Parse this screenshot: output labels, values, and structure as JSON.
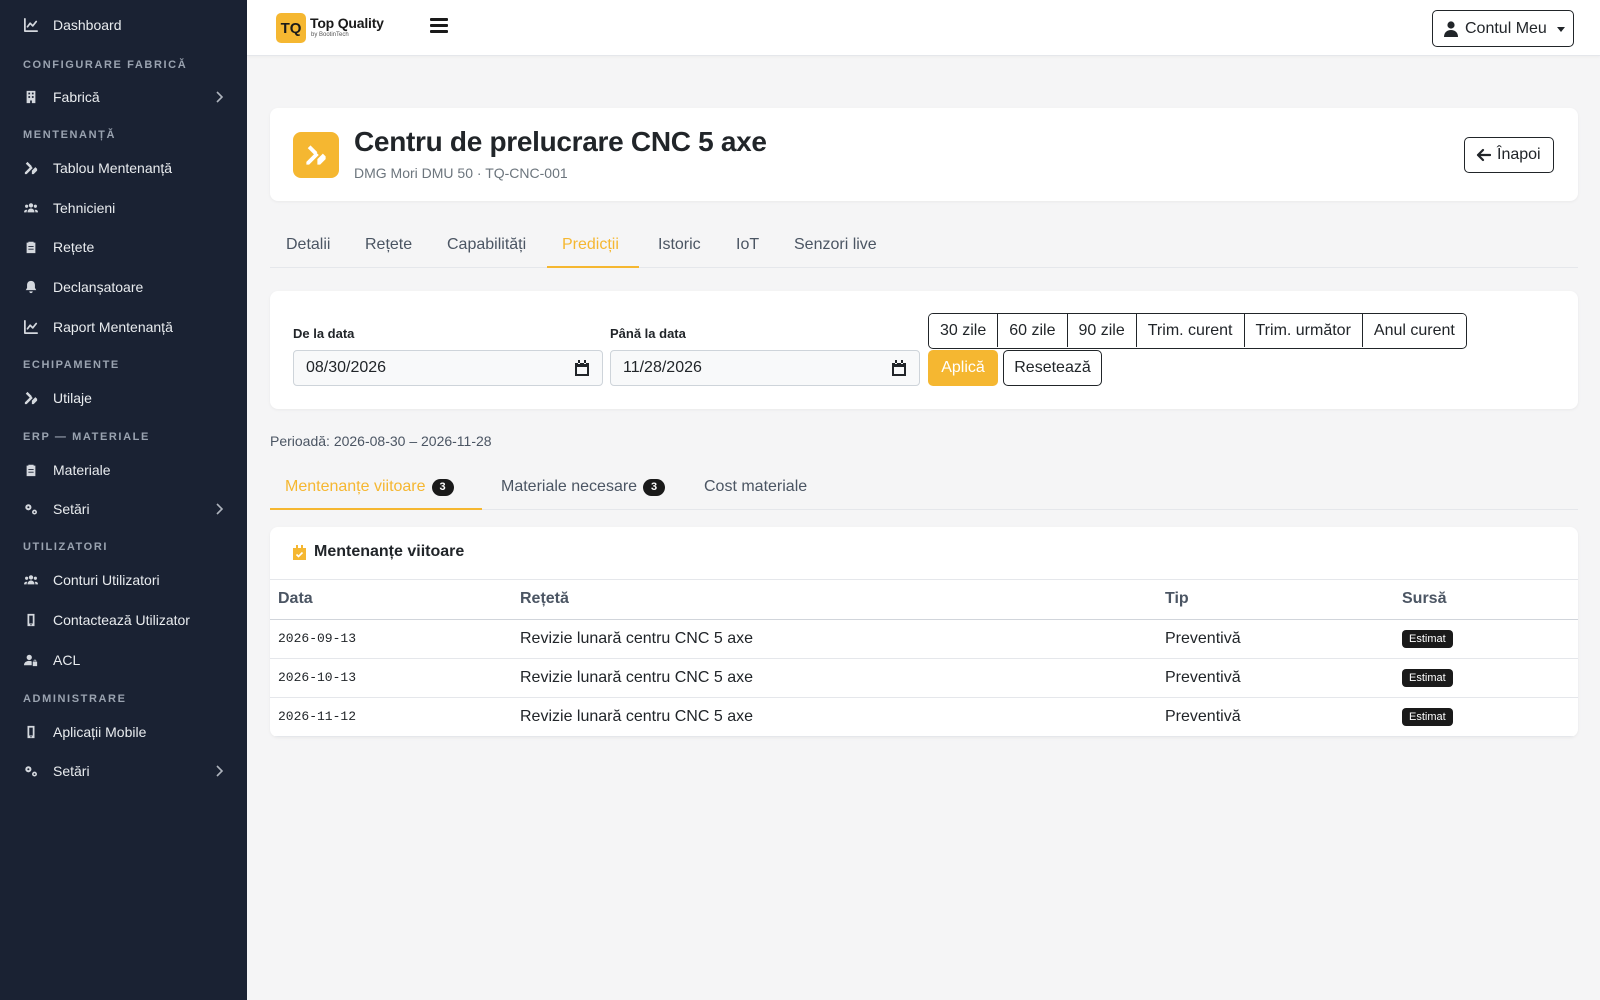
{
  "sidebar": {
    "sections": {
      "config": "Configurare fabrică",
      "maintenance": "Mentenanță",
      "equipment": "Echipamente",
      "erp": "ERP — Materiale",
      "users": "Utilizatori",
      "admin": "Administrare"
    },
    "items": {
      "dashboard": "Dashboard",
      "factory": "Fabrică",
      "maintenance_board": "Tablou Mentenanță",
      "technicians": "Tehnicieni",
      "recipes": "Rețete",
      "triggers": "Declanșatoare",
      "maintenance_report": "Raport Mentenanță",
      "tools": "Utilaje",
      "materials": "Materiale",
      "erp_settings": "Setări",
      "user_accounts": "Conturi Utilizatori",
      "contact_user": "Contactează Utilizator",
      "acl": "ACL",
      "mobile_apps": "Aplicații Mobile",
      "admin_settings": "Setări"
    }
  },
  "topbar": {
    "logo_mark": "TQ",
    "logo_title": "Top Quality",
    "logo_sub": "by BootinTech",
    "account_label": "Contul Meu"
  },
  "header": {
    "title": "Centru de prelucrare CNC 5 axe",
    "subtitle": "DMG Mori DMU 50 · TQ-CNC-001",
    "back_label": "Înapoi"
  },
  "tabs": [
    "Detalii",
    "Rețete",
    "Capabilități",
    "Predicții",
    "Istoric",
    "IoT",
    "Senzori live"
  ],
  "filters": {
    "from_label": "De la data",
    "from_value": "08/30/2026",
    "to_label": "Până la data",
    "to_value": "11/28/2026",
    "presets": [
      "30 zile",
      "60 zile",
      "90 zile",
      "Trim. curent",
      "Trim. următor",
      "Anul curent"
    ],
    "apply_label": "Aplică",
    "reset_label": "Resetează"
  },
  "period_text": "Perioadă: 2026-08-30 – 2026-11-28",
  "subtabs": {
    "upcoming": {
      "label": "Mentenanțe viitoare",
      "count": "3"
    },
    "materials": {
      "label": "Materiale necesare",
      "count": "3"
    },
    "cost": {
      "label": "Cost materiale"
    }
  },
  "table": {
    "title": "Mentenanțe viitoare",
    "columns": [
      "Data",
      "Rețetă",
      "Tip",
      "Sursă"
    ],
    "rows": [
      {
        "date": "2026-09-13",
        "recipe": "Revizie lunară centru CNC 5 axe",
        "type": "Preventivă",
        "source": "Estimat"
      },
      {
        "date": "2026-10-13",
        "recipe": "Revizie lunară centru CNC 5 axe",
        "type": "Preventivă",
        "source": "Estimat"
      },
      {
        "date": "2026-11-12",
        "recipe": "Revizie lunară centru CNC 5 axe",
        "type": "Preventivă",
        "source": "Estimat"
      }
    ]
  },
  "colors": {
    "accent": "#f5b731",
    "sidebar_bg": "#1a2233"
  }
}
